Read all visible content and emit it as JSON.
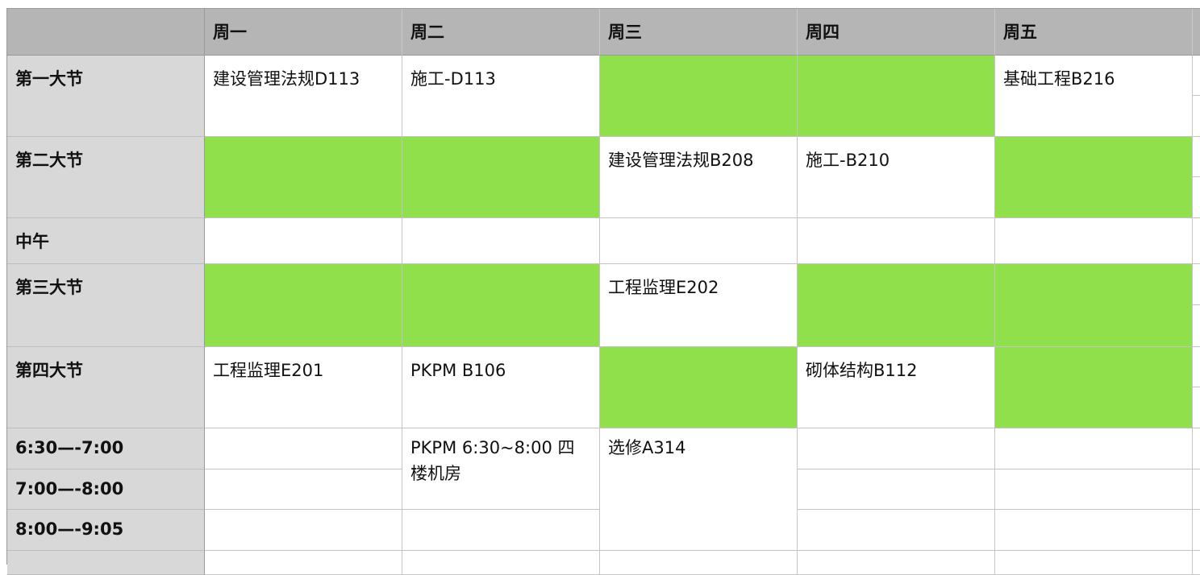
{
  "header": {
    "corner": "",
    "days": [
      "周一",
      "周二",
      "周三",
      "周四",
      "周五"
    ]
  },
  "rows": [
    {
      "label": "第一大节",
      "cells": [
        "建设管理法规D113",
        "施工-D113",
        "",
        "",
        "基础工程B216"
      ],
      "green": [
        false,
        false,
        true,
        true,
        false
      ]
    },
    {
      "label": "第二大节",
      "cells": [
        "",
        "",
        "建设管理法规B208",
        "施工-B210",
        ""
      ],
      "green": [
        true,
        true,
        false,
        false,
        true
      ]
    },
    {
      "label": "中午",
      "cells": [
        "",
        "",
        "",
        "",
        ""
      ],
      "green": [
        false,
        false,
        false,
        false,
        false
      ]
    },
    {
      "label": "第三大节",
      "cells": [
        "",
        "",
        "工程监理E202",
        "",
        ""
      ],
      "green": [
        true,
        true,
        false,
        true,
        true
      ]
    },
    {
      "label": "第四大节",
      "cells": [
        "工程监理E201",
        "PKPM B106",
        "",
        "砌体结构B112",
        ""
      ],
      "green": [
        false,
        false,
        true,
        false,
        true
      ]
    }
  ],
  "evening": {
    "labels": [
      "6:30—-7:00",
      "7:00—-8:00",
      "8:00—-9:05"
    ],
    "tue_text": "PKPM 6:30~8:00 四楼机房",
    "wed_text": "选修A314"
  },
  "colors": {
    "header_bg": "#b4b5b4",
    "row_header_bg": "#d8d8d8",
    "free_green": "#8fe04a",
    "grid": "#c4c4c4"
  }
}
